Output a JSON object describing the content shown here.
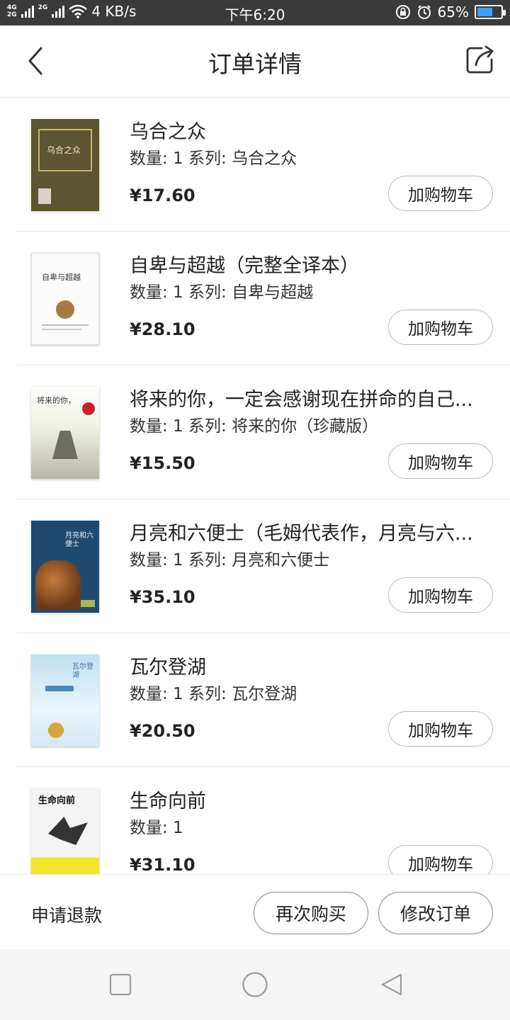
{
  "status_bar": {
    "net_top": "4G",
    "net_bottom": "2G",
    "net2": "2G",
    "speed": "4 KB/s",
    "time": "下午6:20",
    "battery": "65%",
    "battery_level": 0.65
  },
  "header": {
    "title": "订单详情",
    "back_icon": "chevron-left-icon",
    "share_icon": "share-icon"
  },
  "items": [
    {
      "name": "乌合之众",
      "meta": "数量: 1 系列: 乌合之众",
      "price": "¥17.60",
      "button": "加购物车",
      "cover_text": "乌合之众"
    },
    {
      "name": "自卑与超越（完整全译本）",
      "meta": "数量: 1 系列: 自卑与超越",
      "price": "¥28.10",
      "button": "加购物车",
      "cover_text": "自卑与超越"
    },
    {
      "name": "将来的你，一定会感谢现在拼命的自己...",
      "meta": "数量: 1 系列: 将来的你（珍藏版）",
      "price": "¥15.50",
      "button": "加购物车",
      "cover_text": "将来的你，"
    },
    {
      "name": "月亮和六便士（毛姆代表作，月亮与六...",
      "meta": "数量: 1 系列: 月亮和六便士",
      "price": "¥35.10",
      "button": "加购物车",
      "cover_text": "月亮和六便士"
    },
    {
      "name": "瓦尔登湖",
      "meta": "数量: 1 系列: 瓦尔登湖",
      "price": "¥20.50",
      "button": "加购物车",
      "cover_text": "瓦尔登湖"
    },
    {
      "name": "生命向前",
      "meta": "数量: 1",
      "price": "¥31.10",
      "button": "加购物车",
      "cover_text": "生命向前"
    }
  ],
  "actions": {
    "refund": "申请退款",
    "rebuy": "再次购买",
    "modify": "修改订单"
  },
  "navbar": {
    "recent_icon": "square-icon",
    "home_icon": "circle-icon",
    "back_icon": "triangle-back-icon"
  }
}
